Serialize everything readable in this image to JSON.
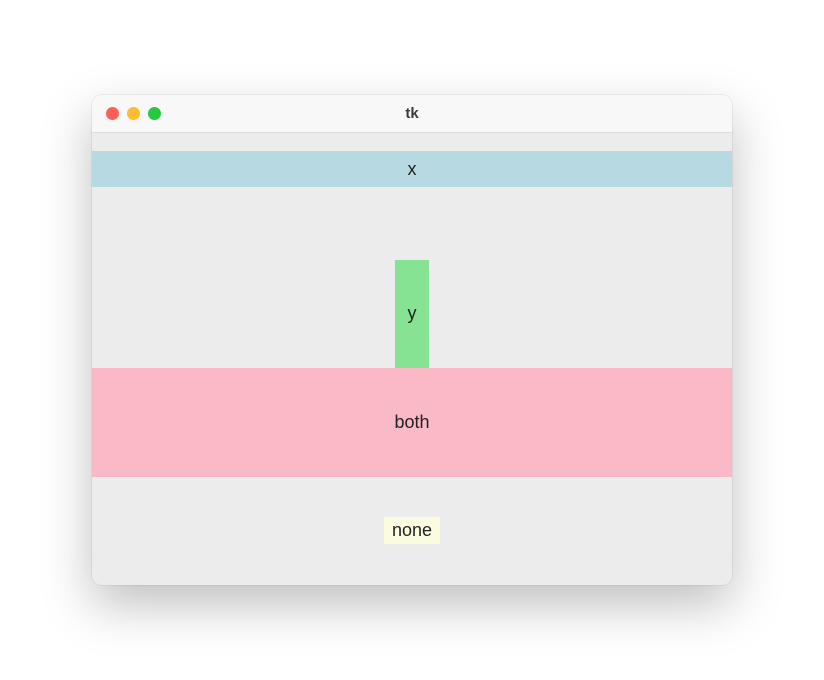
{
  "window": {
    "title": "tk"
  },
  "labels": {
    "x": "x",
    "y": "y",
    "both": "both",
    "none": "none"
  },
  "colors": {
    "x_bg": "#b7d9e2",
    "y_bg": "#86e393",
    "both_bg": "#f9b9c7",
    "none_bg": "#fbfcdf"
  }
}
